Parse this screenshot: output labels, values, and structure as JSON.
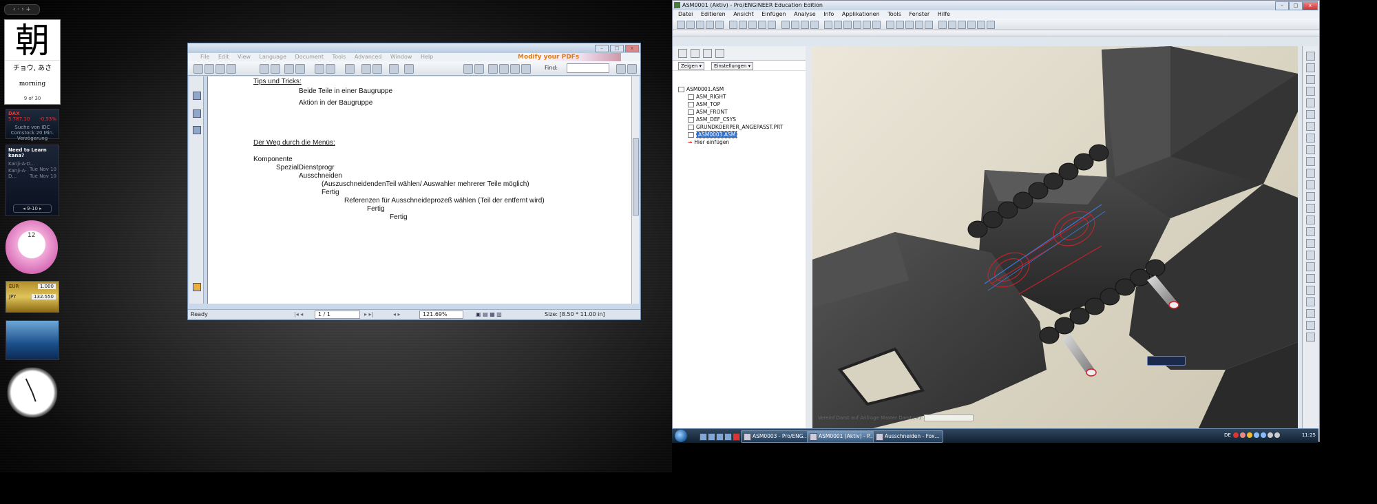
{
  "sidebar": {
    "kanji_widget": {
      "kanji": "朝",
      "reading": "チョウ, あさ",
      "meaning": "morning",
      "page": "9 of 30"
    },
    "stock_widget": {
      "index": "DAX",
      "value": "5.787,10",
      "change": "-0,53%",
      "note": "Suche von IDC Comstock 20 Min. Verzögerung"
    },
    "kana_widget": {
      "title": "Need to Learn kana?",
      "rows": [
        {
          "left": "Kanji-A-D...",
          "right": "Tue Nov 10"
        },
        {
          "left": "Kanji-A-D...",
          "right": "Tue Nov 10"
        }
      ],
      "range": "9-10"
    },
    "cat_clock": {
      "number": "12"
    },
    "currency_widget": {
      "rows": [
        {
          "cur": "EUR",
          "value": "1.000"
        },
        {
          "cur": "JPY",
          "value": "132.550"
        }
      ]
    }
  },
  "pdf_viewer": {
    "menu": [
      "File",
      "Edit",
      "View",
      "Language",
      "Document",
      "Tools",
      "Advanced",
      "Window",
      "Help"
    ],
    "ad": "Modify your PDFs",
    "find_label": "Find:",
    "content": [
      {
        "text": "Tips und Tricks:",
        "underline": true
      },
      {
        "text": "Beide Teile in einer Baugruppe",
        "underline": false
      },
      {
        "text": "Aktion in der Baugruppe",
        "underline": false
      },
      {
        "text": "Der Weg durch die Menüs:",
        "underline": true
      },
      {
        "text": "Komponente",
        "underline": false
      },
      {
        "text": "SpezialDienstprogr",
        "underline": false
      },
      {
        "text": "Ausschneiden",
        "underline": false
      },
      {
        "text": "(AuszuschneidendenTeil wählen/ Auswahler mehrerer Teile möglich)",
        "underline": false
      },
      {
        "text": "Fertig",
        "underline": false
      },
      {
        "text": "Referenzen für Ausschneideprozeß wählen (Teil der entfernt wird)",
        "underline": false
      },
      {
        "text": "Fertig",
        "underline": false
      },
      {
        "text": "Fertig",
        "underline": false
      }
    ],
    "status": {
      "state": "Ready",
      "page": "1 / 1",
      "zoom": "121.69%",
      "size": "Size: [8.50 * 11.00 in]"
    }
  },
  "proe": {
    "title": "ASM0001 (Aktiv) - Pro/ENGINEER Education Edition",
    "menu": [
      "Datei",
      "Editieren",
      "Ansicht",
      "Einfügen",
      "Analyse",
      "Info",
      "Applikationen",
      "Tools",
      "Fenster",
      "Hilfe"
    ],
    "tree_dropdowns": [
      "Zeigen",
      "Einstellungen"
    ],
    "tree": [
      {
        "label": "ASM0001.ASM",
        "level": 0,
        "selected": false,
        "insert": false
      },
      {
        "label": "ASM_RIGHT",
        "level": 1,
        "selected": false,
        "insert": false
      },
      {
        "label": "ASM_TOP",
        "level": 1,
        "selected": false,
        "insert": false
      },
      {
        "label": "ASM_FRONT",
        "level": 1,
        "selected": false,
        "insert": false
      },
      {
        "label": "ASM_DEF_CSYS",
        "level": 1,
        "selected": false,
        "insert": false
      },
      {
        "label": "GRUNDKOERPER_ANGEPASST.PRT",
        "level": 1,
        "selected": false,
        "insert": false
      },
      {
        "label": "ASM0003.ASM",
        "level": 1,
        "selected": true,
        "insert": false
      },
      {
        "label": "Hier einfügen",
        "level": 1,
        "selected": false,
        "insert": true
      }
    ],
    "status_message": "Vereinf Darst auf Anfrage Master Darst (+)"
  },
  "taskbar": {
    "buttons": [
      {
        "label": "ASM0003 - Pro/ENG...",
        "active": false
      },
      {
        "label": "ASM0001 (Aktiv) - P...",
        "active": true
      },
      {
        "label": "Ausschneiden - Fox...",
        "active": false
      }
    ],
    "lang": "DE",
    "time": "11:25"
  },
  "colors": {
    "accent": "#2f6fd0",
    "pdf_ad": "#e07a10",
    "model": "#3a3a3a",
    "highlight": "#d0202a"
  }
}
